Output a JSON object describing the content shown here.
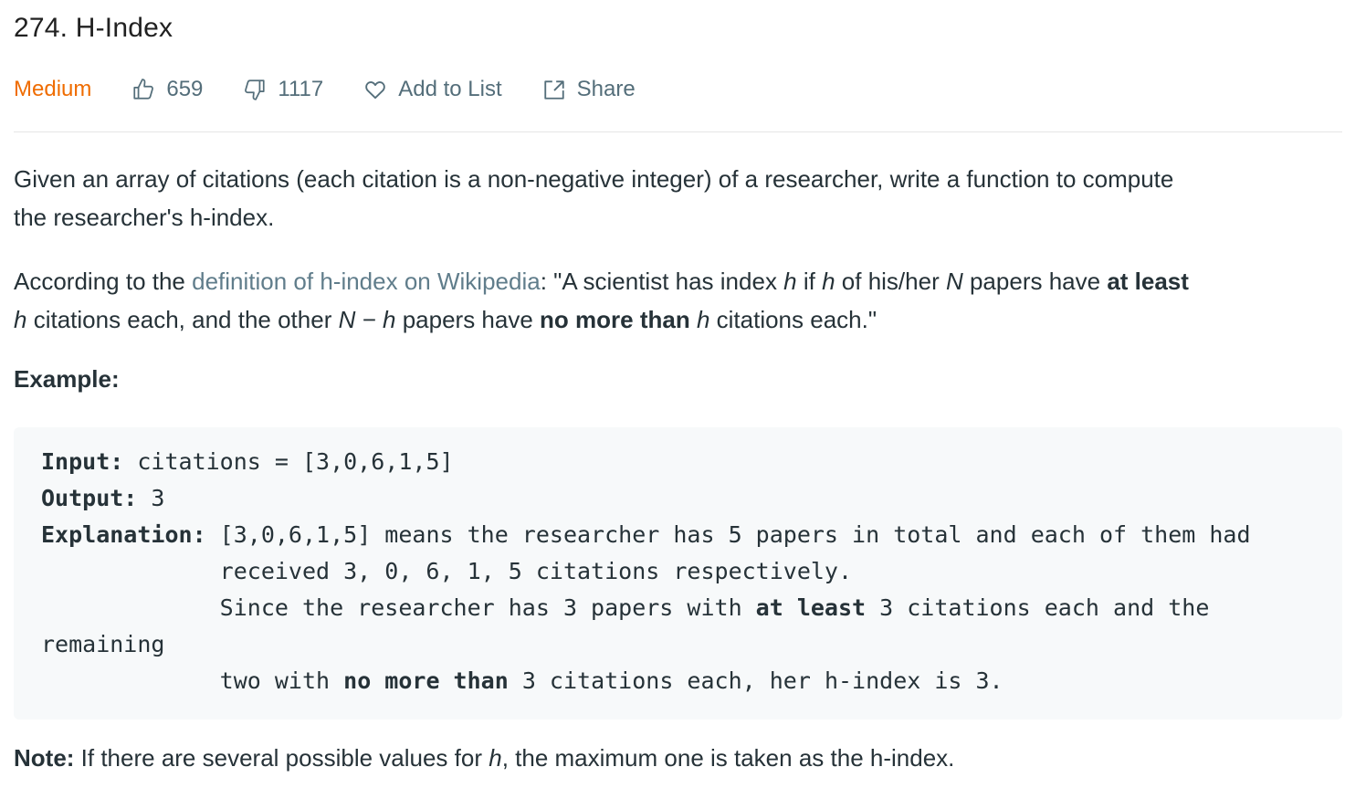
{
  "title": "274. H-Index",
  "meta": {
    "difficulty": "Medium",
    "likes": "659",
    "dislikes": "1117",
    "add_to_list": "Add to List",
    "share": "Share",
    "colors": {
      "difficulty": "#ef6c00",
      "meta": "#546e7a",
      "link": "#607d8b"
    },
    "icons": [
      "thumbs-up-icon",
      "thumbs-down-icon",
      "heart-icon",
      "share-icon"
    ]
  },
  "description": {
    "p1_line1": "Given an array of citations (each citation is a non-negative integer) of a researcher, write a function to compute",
    "p1_line2": "the researcher's h-index.",
    "p2": {
      "t1": "According to the ",
      "link": "definition of h-index on Wikipedia",
      "t2": ": \"A scientist has index ",
      "h": "h",
      "if": " if ",
      "t3": " of his/her ",
      "N": "N",
      "t4": " papers have ",
      "at_least": "at least",
      "t5": " citations each, and the other ",
      "NmH": "N − h",
      "t6": " papers have ",
      "no_more_than": "no more than",
      "t7": " citations each.\""
    }
  },
  "example": {
    "heading": "Example:",
    "input_label": "Input:",
    "input_value": " citations = [3,0,6,1,5]",
    "output_label": "Output:",
    "output_value": " 3",
    "explanation_label": "Explanation:",
    "e1": " [3,0,6,1,5] means the researcher has 5 papers in total and each of them had",
    "e2": "             received 3, 0, 6, 1, 5 citations respectively.",
    "e3a": "             Since the researcher has 3 papers with ",
    "e3b": "at least",
    "e3c": " 3 citations each and the",
    "e4": "remaining",
    "e5a": "             two with ",
    "e5b": "no more than",
    "e5c": " 3 citations each, her h-index is 3."
  },
  "note": {
    "label": "Note:",
    "t1": " If there are several possible values for ",
    "h": "h",
    "t2": ", the maximum one is taken as the h-index."
  }
}
